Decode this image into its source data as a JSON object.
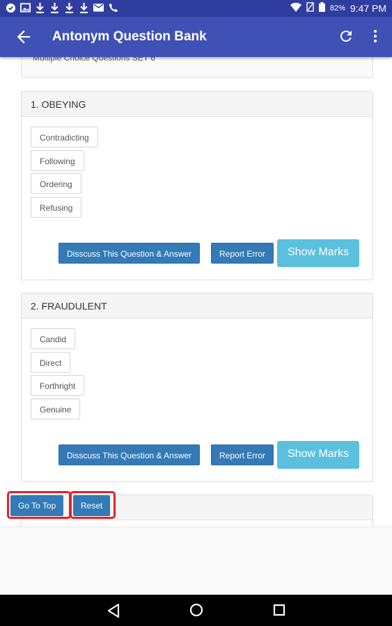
{
  "status_bar": {
    "battery": "82%",
    "time": "9:47 PM"
  },
  "app_bar": {
    "title": "Antonym Question Bank"
  },
  "set_label": "Multiple Choice Questions SET 6",
  "questions": [
    {
      "title": "1. OBEYING",
      "options": [
        "Contradicting",
        "Following",
        "Ordering",
        "Refusing"
      ],
      "discuss_label": "Disscuss This Question & Answer",
      "report_label": "Report Error",
      "marks_label": "Show Marks"
    },
    {
      "title": "2. FRAUDULENT",
      "options": [
        "Candid",
        "Direct",
        "Forthright",
        "Genuine"
      ],
      "discuss_label": "Disscuss This Question & Answer",
      "report_label": "Report Error",
      "marks_label": "Show Marks"
    }
  ],
  "floating": {
    "top_label": "Go To Top",
    "reset_label": "Reset"
  },
  "colors": {
    "status_bar": "#2f3e9e",
    "app_bar": "#3f51b5",
    "primary_button": "#337ab7",
    "info_button": "#5bc0de",
    "highlight_border": "#e8202a"
  }
}
